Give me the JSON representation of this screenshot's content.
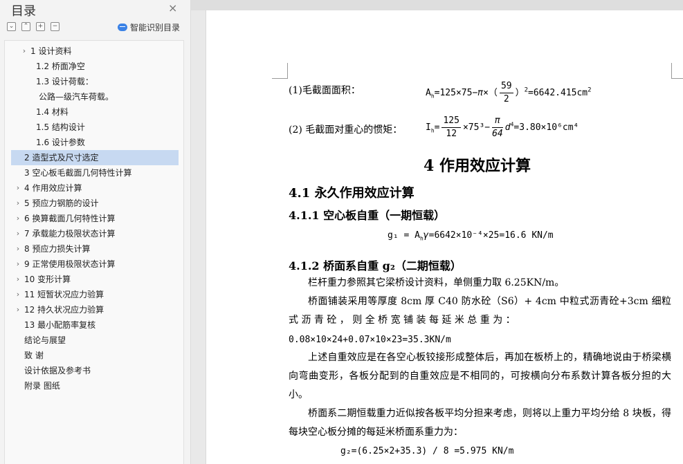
{
  "sidebar": {
    "title": "目录",
    "close_glyph": "×",
    "tools": [
      "⌄",
      "⌃",
      "+",
      "−"
    ],
    "smart_label": "智能识别目录",
    "items": [
      {
        "label": "1 设计资料",
        "caret": "›"
      },
      {
        "label": "1.2 桥面净空",
        "caret": ""
      },
      {
        "label": "1.3 设计荷载：",
        "caret": ""
      },
      {
        "label": "公路—级汽车荷载。",
        "caret": ""
      },
      {
        "label": "1.4 材料",
        "caret": ""
      },
      {
        "label": "1.5 结构设计",
        "caret": ""
      },
      {
        "label": "1.6 设计参数",
        "caret": ""
      },
      {
        "label": "2 造型式及尺寸选定",
        "caret": ""
      },
      {
        "label": "3 空心板毛截面几何特性计算",
        "caret": ""
      },
      {
        "label": "4 作用效应计算",
        "caret": "›"
      },
      {
        "label": "5 预应力钢筋的设计",
        "caret": "›"
      },
      {
        "label": "6 换算截面几何特性计算",
        "caret": "›"
      },
      {
        "label": "7 承载能力极限状态计算",
        "caret": "›"
      },
      {
        "label": "8 预应力损失计算",
        "caret": "›"
      },
      {
        "label": "9 正常使用极限状态计算",
        "caret": "›"
      },
      {
        "label": "10 变形计算",
        "caret": "›"
      },
      {
        "label": "11 短暂状况应力验算",
        "caret": "›"
      },
      {
        "label": "12 持久状况应力验算",
        "caret": "›"
      },
      {
        "label": "13 最小配筋率复核",
        "caret": ""
      },
      {
        "label": "结论与展望",
        "caret": ""
      },
      {
        "label": "致 谢",
        "caret": ""
      },
      {
        "label": "设计依据及参考书",
        "caret": ""
      },
      {
        "label": "附录    图纸",
        "caret": ""
      }
    ],
    "active_index": 7
  },
  "doc": {
    "l1_prefix": "(1)毛截面面积：",
    "l1_formula_a": "A",
    "l1_formula_sub": "h",
    "l1_formula_b": "=125×75−",
    "l1_pi": "π",
    "l1_times": "×（",
    "l1_frac_num": "59",
    "l1_frac_den": "2",
    "l1_formula_c": "）",
    "l1_sup": "2",
    "l1_result": "=6642.415cm",
    "l1_result_sup": "2",
    "l2_prefix": "(2) 毛截面对重心的惯矩：",
    "l2_I": "I",
    "l2_I_sub": "h",
    "l2_eq": "=",
    "l2_frac1_num": "125",
    "l2_frac1_den": "12",
    "l2_mid": "×75³−",
    "l2_frac2_num": "π",
    "l2_frac2_den": "64",
    "l2_d": "d",
    "l2_d_sup": "4",
    "l2_result": "=3.80×10⁶cm⁴",
    "h1": "4 作用效应计算",
    "h2_41": "4.1 永久作用效应计算",
    "h3_411": "4.1.1 空心板自重（一期恒载）",
    "g1_formula": "g₁ = A",
    "g1_sub": "h",
    "g1_gamma": "γ",
    "g1_rest": "=6642×10⁻⁴×25=16.6 KN/m",
    "h3_412": "4.1.2 桥面系自重 g₂（二期恒载）",
    "p1": "栏杆重力参照其它梁桥设计资料，单侧重力取 6.25KN/m。",
    "p2": "桥面铺装采用等厚度 8cm 厚 C40 防水砼（S6）+ 4cm 中粒式沥青砼+3cm 细粒 式 沥 青 砼 ， 则 全 桥 宽 铺 装 每 延 米 总 重 为 ：",
    "p2_last": "0.08×10×24+0.07×10×23=35.3KN/m",
    "p3": "上述自重效应是在各空心板铰接形成整体后，再加在板桥上的，精确地说由于桥梁横向弯曲变形，各板分配到的自重效应是不相同的，可按横向分布系数计算各板分担的大小。",
    "p4": "桥面系二期恒载重力近似按各板平均分担来考虑，则将以上重力平均分给 8 块板，得每块空心板分摊的每延米桥面系重力为：",
    "g2_formula": "g₂=(6.25×2+35.3) / 8 =5.975 KN/m"
  }
}
